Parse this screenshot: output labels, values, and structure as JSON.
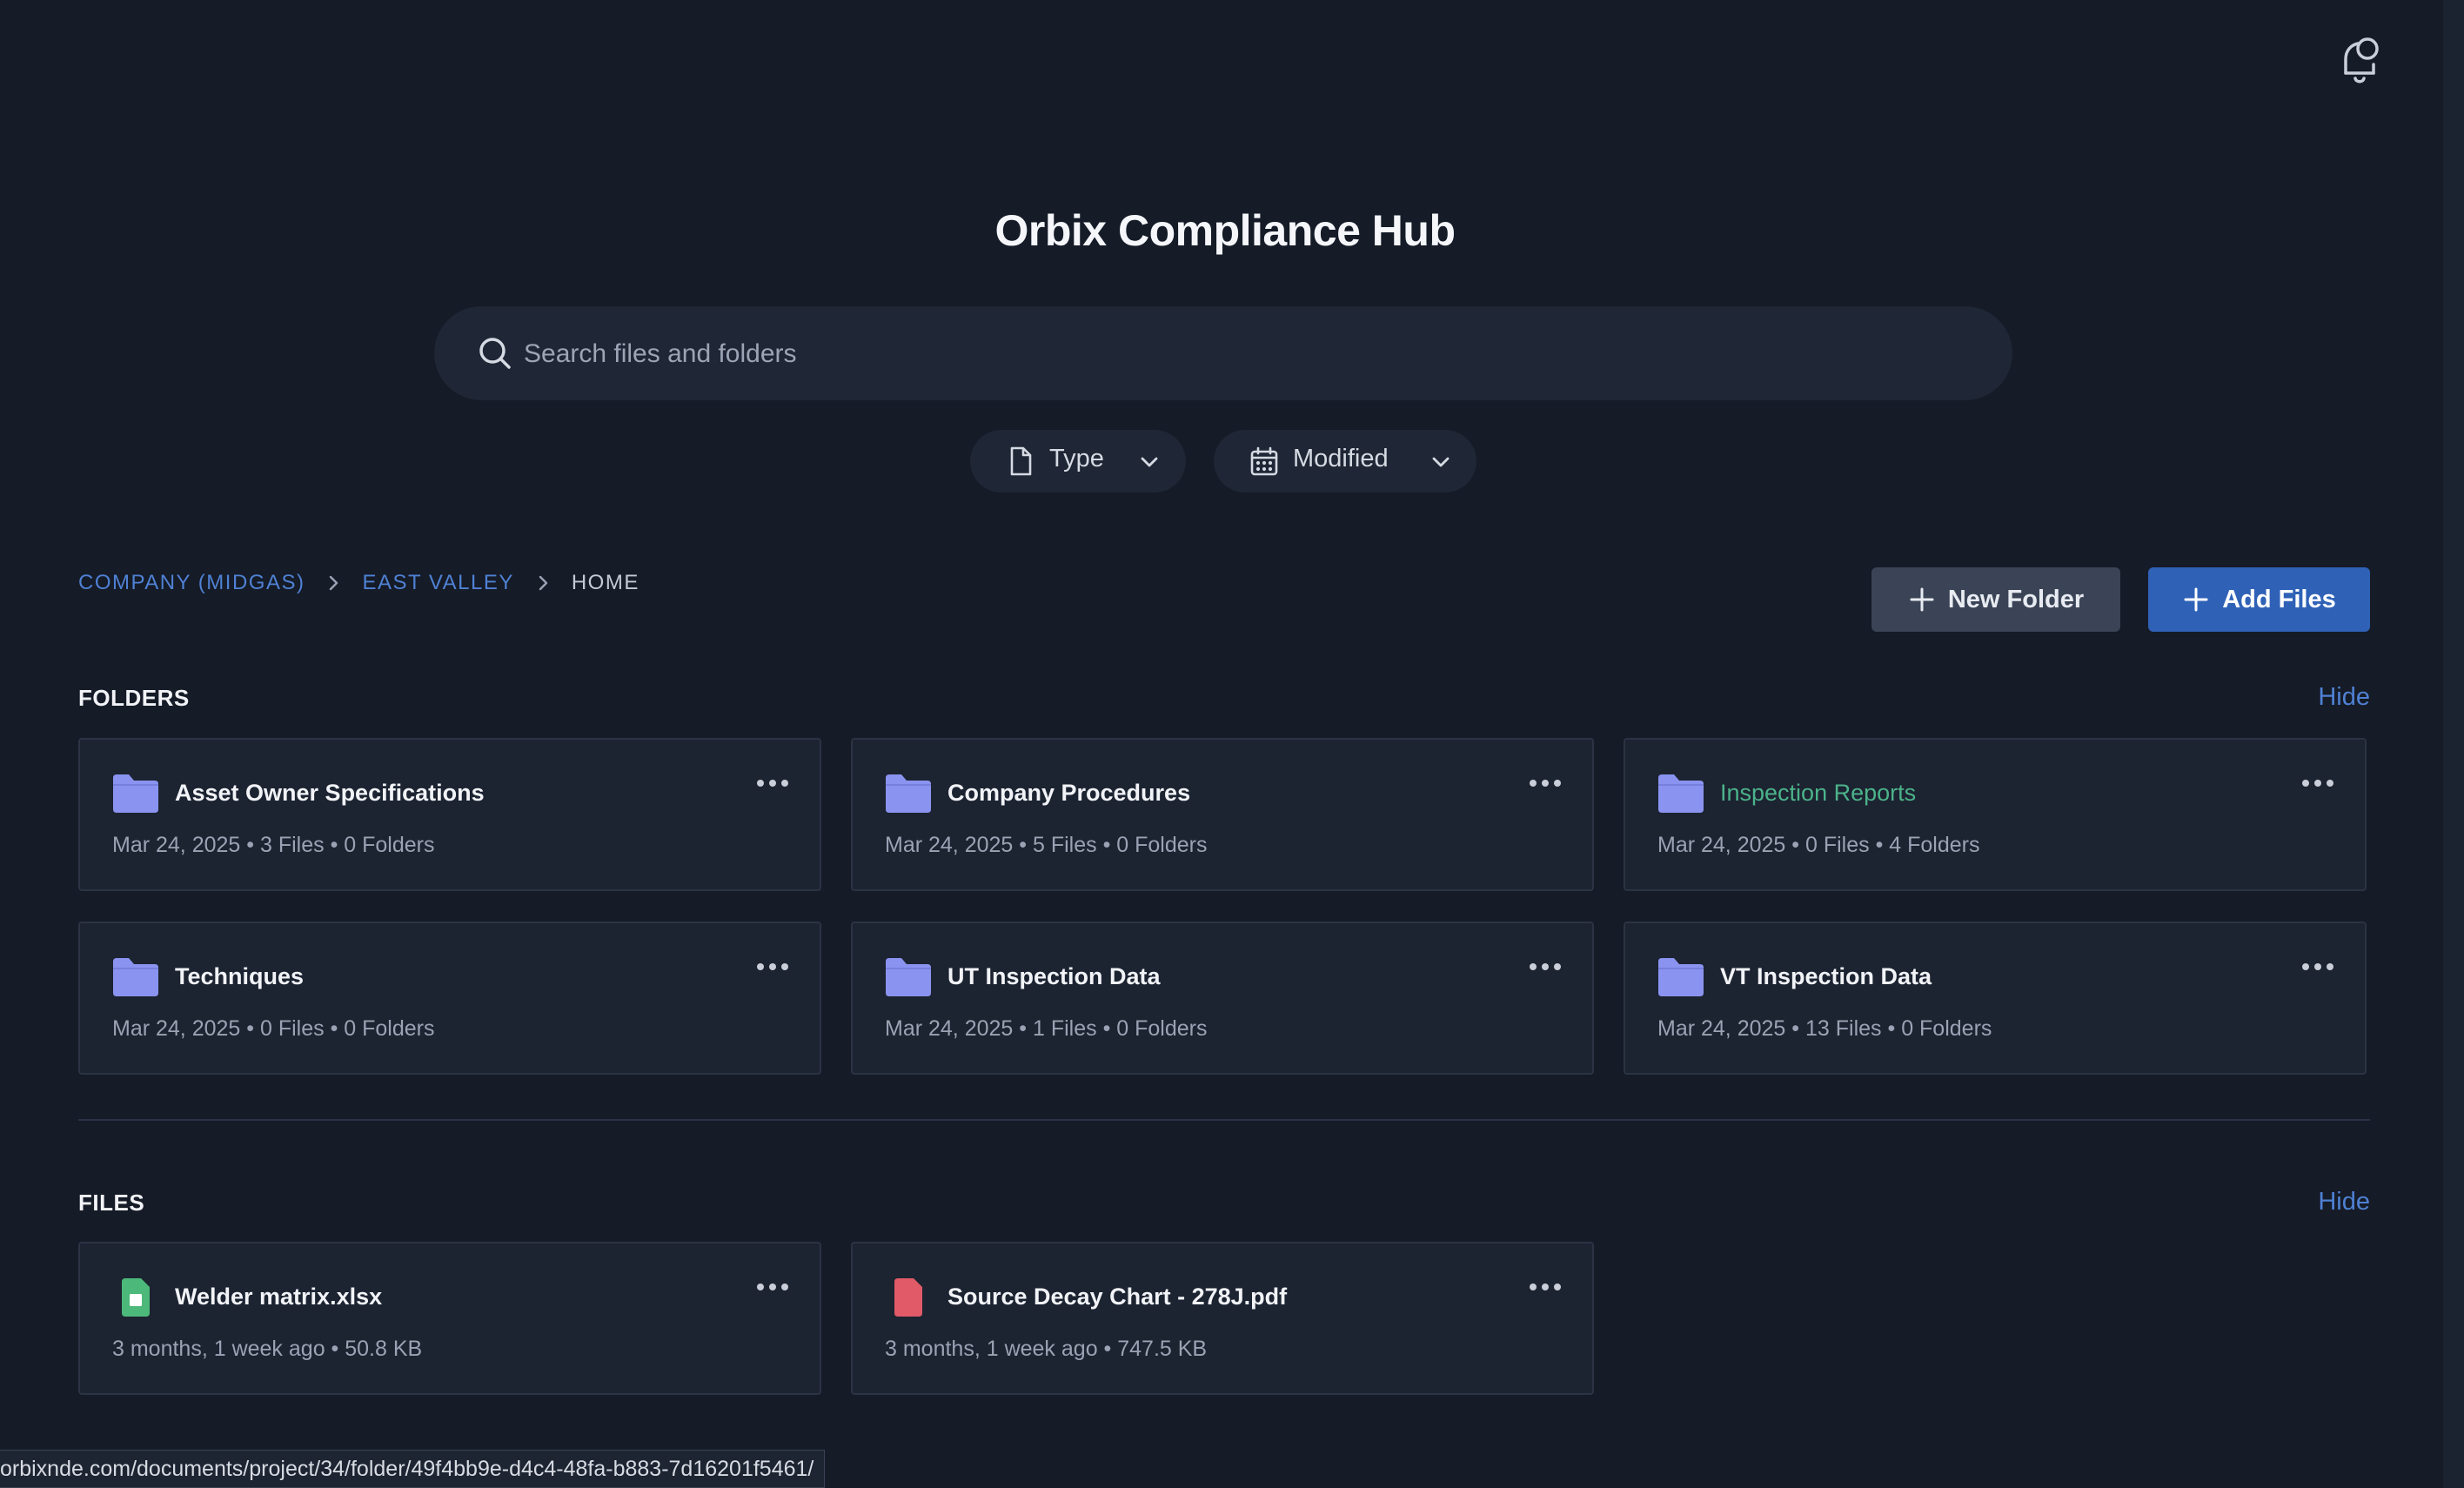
{
  "header": {
    "title": "Orbix Compliance Hub",
    "notification_icon": "bell-icon"
  },
  "search": {
    "placeholder": "Search files and folders",
    "value": ""
  },
  "filters": {
    "type_label": "Type",
    "modified_label": "Modified"
  },
  "breadcrumb": {
    "items": [
      "COMPANY (MIDGAS)",
      "EAST VALLEY",
      "HOME"
    ]
  },
  "actions": {
    "new_folder_label": "New Folder",
    "add_files_label": "Add Files"
  },
  "folders_section": {
    "title": "FOLDERS",
    "hide_label": "Hide",
    "items": [
      {
        "name": "Asset Owner Specifications",
        "date": "Mar 24, 2025",
        "files": "3 Files",
        "folders": "0 Folders"
      },
      {
        "name": "Company Procedures",
        "date": "Mar 24, 2025",
        "files": "5 Files",
        "folders": "0 Folders"
      },
      {
        "name": "Inspection Reports",
        "date": "Mar 24, 2025",
        "files": "0 Files",
        "folders": "4 Folders"
      },
      {
        "name": "Techniques",
        "date": "Mar 24, 2025",
        "files": "0 Files",
        "folders": "0 Folders"
      },
      {
        "name": "UT Inspection Data",
        "date": "Mar 24, 2025",
        "files": "1 Files",
        "folders": "0 Folders"
      },
      {
        "name": "VT Inspection Data",
        "date": "Mar 24, 2025",
        "files": "13 Files",
        "folders": "0 Folders"
      }
    ]
  },
  "files_section": {
    "title": "FILES",
    "hide_label": "Hide",
    "items": [
      {
        "name": "Welder matrix.xlsx",
        "modified": "3 months, 1 week ago",
        "size": "50.8 KB"
      },
      {
        "name": "Source Decay Chart - 278J.pdf",
        "modified": "3 months, 1 week ago",
        "size": "747.5 KB"
      }
    ]
  },
  "colors": {
    "background": "#151b27",
    "accent": "#2f62b7",
    "link": "#4f81d3",
    "folder": "#8a94f0",
    "highlight_name": "#4cb38a",
    "xlsx": "#4cb87a",
    "pdf": "#e05a67"
  },
  "status_bar": {
    "url": "orbixnde.com/documents/project/34/folder/49f4bb9e-d4c4-48fa-b883-7d16201f5461/"
  }
}
